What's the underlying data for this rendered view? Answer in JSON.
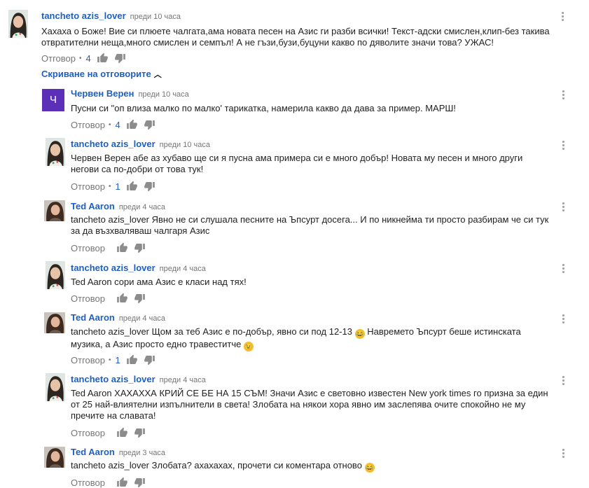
{
  "top_comment": {
    "author": "tancheto azis_lover",
    "time": "преди 10 часа",
    "text": "Хахаха о Боже! Вие си плюете чалгата,ама новата песен на Азис ги разби всички! Текст-адски смислен,клип-без такива отвратителни неща,много смислен и семпъл! А не гъзи,бузи,буцуни какво по дяволите значи това? УЖАС!",
    "reply_label": "Отговор",
    "likes": "4"
  },
  "replies_toggle": {
    "label": "Скриване на отговорите",
    "icon": "chevron-up-icon"
  },
  "replies": [
    {
      "author": "Червен Верен",
      "avatar_letter": "Ч",
      "time": "преди 10 часа",
      "text": "Пусни си \"оп влиза малко по малко' тарикатка, намерила какво да дава за пример. МАРШ!",
      "reply_label": "Отговор",
      "likes": "4"
    },
    {
      "author": "tancheto azis_lover",
      "time": "преди 10 часа",
      "text": "Червен Верен абе аз хубаво ще си я пусна ама примера си е много добър! Новата му песен и много други негови са по-добри от това тук!",
      "reply_label": "Отговор",
      "likes": "1"
    },
    {
      "author": "Ted Aaron",
      "time": "преди 4 часа",
      "text": "tancheto azis_lover Явно не си слушала песните на Ъпсурт досега... И по никнейма ти просто разбирам че си тук за да възхваляваш чалгаря Азис",
      "reply_label": "Отговор",
      "likes": ""
    },
    {
      "author": "tancheto azis_lover",
      "time": "преди 4 часа",
      "text": "Ted Aaron сори ама Азис е класи над тях!",
      "reply_label": "Отговор",
      "likes": ""
    },
    {
      "author": "Ted Aaron",
      "time": "преди 4 часа",
      "text_a": "tancheto azis_lover Щом за теб Азис е по-добър, явно си под 12-13",
      "text_b": "Навремето Ъпсурт беше истинската музика, а Азис просто едно травеститче",
      "reply_label": "Отговор",
      "likes": "1"
    },
    {
      "author": "tancheto azis_lover",
      "time": "преди 4 часа",
      "text": "Ted Aaron ХАХАХХА КРИЙ СЕ БЕ НА 15 СЪМ! Значи Азис е световно известен New york times го призна за един от 25 най-влиятелни изпълнители в света! Злобата на някои хора явно им заслепява очите спокойно не му пречите на славата!",
      "reply_label": "Отговор",
      "likes": ""
    },
    {
      "author": "Ted Aaron",
      "time": "преди 3 часа",
      "text": "tancheto azis_lover Злобата? ахахахах, прочети си коментара отново",
      "reply_label": "Отговор",
      "likes": ""
    }
  ],
  "colors": {
    "author": "#1f5fbf",
    "meta": "#767676",
    "avatar_letter_bg": "#5b2fb8"
  }
}
